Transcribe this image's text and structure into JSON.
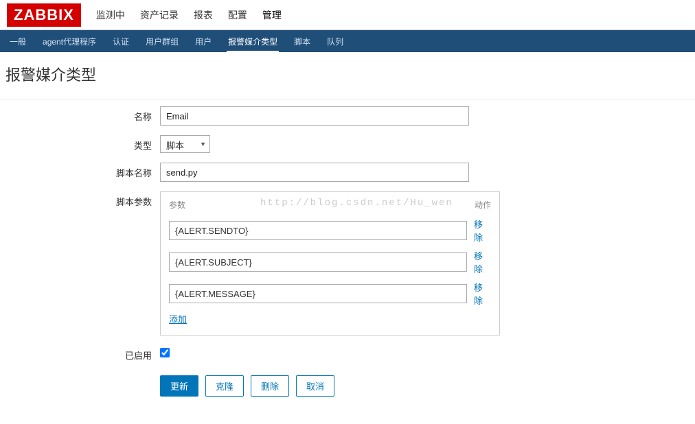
{
  "logo": "ZABBIX",
  "main_nav": {
    "items": [
      "监测中",
      "资产记录",
      "报表",
      "配置",
      "管理"
    ],
    "active_index": 4
  },
  "sub_nav": {
    "items": [
      "一般",
      "agent代理程序",
      "认证",
      "用户群组",
      "用户",
      "报警媒介类型",
      "脚本",
      "队列"
    ],
    "active_index": 5
  },
  "page_title": "报警媒介类型",
  "form": {
    "name_label": "名称",
    "name_value": "Email",
    "type_label": "类型",
    "type_value": "脚本",
    "script_name_label": "脚本名称",
    "script_name_value": "send.py",
    "script_params_label": "脚本参数",
    "params_header_col": "参数",
    "params_header_action": "动作",
    "params": [
      {
        "value": "{ALERT.SENDTO}"
      },
      {
        "value": "{ALERT.SUBJECT}"
      },
      {
        "value": "{ALERT.MESSAGE}"
      }
    ],
    "remove_label": "移除",
    "add_label": "添加",
    "enabled_label": "已启用",
    "enabled_checked": true
  },
  "buttons": {
    "update": "更新",
    "clone": "克隆",
    "delete": "删除",
    "cancel": "取消"
  },
  "watermark": "http://blog.csdn.net/Hu_wen"
}
